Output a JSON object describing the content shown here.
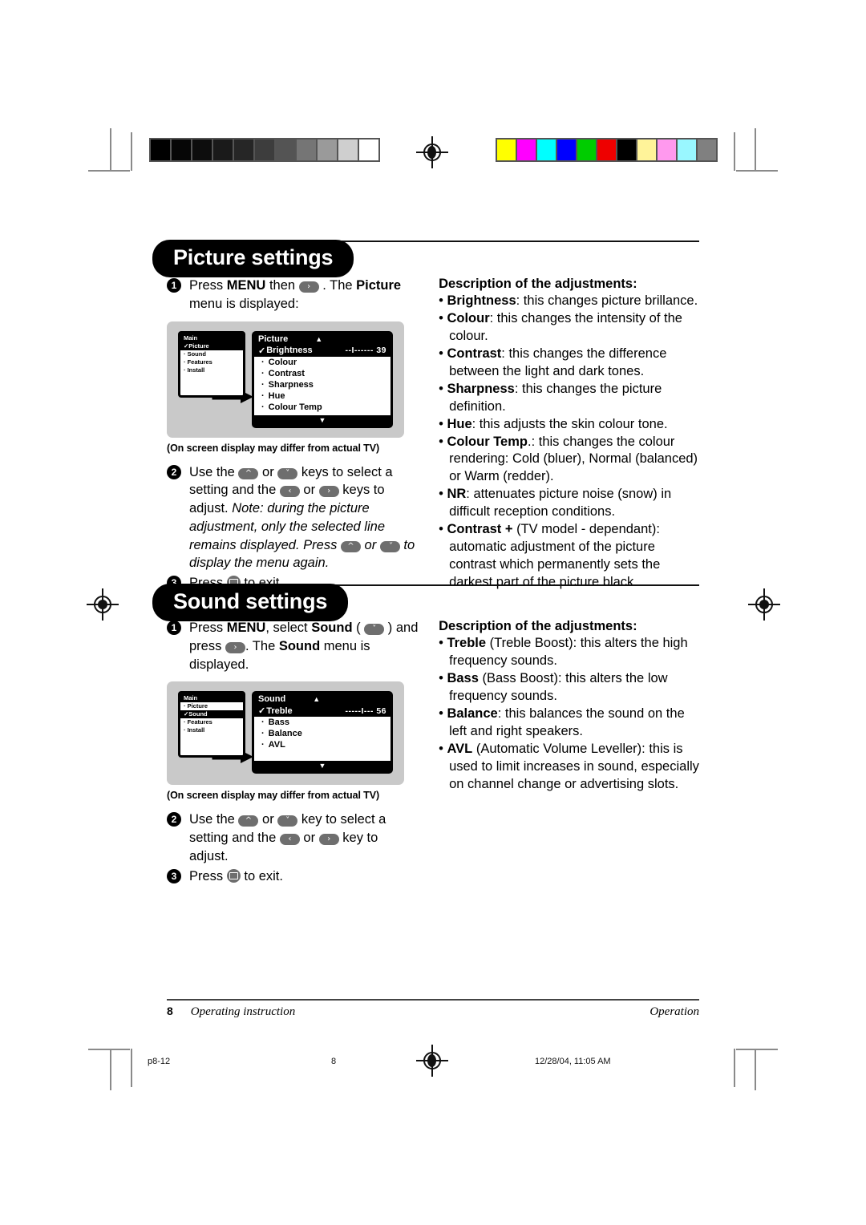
{
  "document": {
    "page_number": "8",
    "footer_left": "Operating instruction",
    "footer_right": "Operation",
    "print_file": "p8-12",
    "print_page": "8",
    "print_timestamp": "12/28/04, 11:05 AM"
  },
  "calibration": {
    "grayscale": [
      "#000000",
      "#060606",
      "#0d0d0d",
      "#1a1a1a",
      "#262626",
      "#3d3d3d",
      "#545454",
      "#757575",
      "#9a9a9a",
      "#cfcfcf",
      "#ffffff"
    ],
    "colors": [
      "#ffff00",
      "#ff00ff",
      "#00ffff",
      "#0000ff",
      "#00cc00",
      "#ee0000",
      "#000000",
      "#fff399",
      "#ff99ee",
      "#99f7ff",
      "#808080"
    ]
  },
  "picture_section": {
    "title": "Picture settings",
    "steps": [
      {
        "num": "1",
        "parts": [
          {
            "t": "text",
            "v": "Press "
          },
          {
            "t": "bold",
            "v": "MENU"
          },
          {
            "t": "text",
            "v": " then "
          },
          {
            "t": "key",
            "v": "right"
          },
          {
            "t": "text",
            "v": " . The "
          },
          {
            "t": "bold",
            "v": "Picture"
          },
          {
            "t": "text",
            "v": " menu is displayed:"
          }
        ]
      }
    ],
    "osd": {
      "sidebar_header": "Main",
      "sidebar_items": [
        {
          "label": "Picture",
          "selected": true
        },
        {
          "label": "Sound",
          "selected": false
        },
        {
          "label": "Features",
          "selected": false
        },
        {
          "label": "Install",
          "selected": false
        }
      ],
      "menu_title": "Picture",
      "up_caret": "▲",
      "down_caret": "▼",
      "highlighted_item": {
        "label": "Brightness",
        "value": "--I------",
        "number": "39",
        "check": "✓"
      },
      "items": [
        "Colour",
        "Contrast",
        "Sharpness",
        "Hue",
        "Colour Temp"
      ],
      "bullet": "·"
    },
    "caption": "(On screen display may differ from actual TV)",
    "step2_prefix": "Use the",
    "step2_or": "or",
    "step2_mid": "keys to select a setting and the",
    "step2_suffix": "keys to adjust.",
    "note_line1": "Note: during the picture adjustment, only",
    "note_line2": "the selected line remains displayed. Press",
    "note_line3_or": "or",
    "note_line3_tail": "to display the menu again.",
    "step3_press": "Press",
    "step3_tail": "to exit.",
    "desc_title": "Description of the adjustments:",
    "descriptions": [
      {
        "term": "Brightness",
        "rest": ": this changes picture brillance."
      },
      {
        "term": "Colour",
        "rest": ": this changes the intensity of the colour."
      },
      {
        "term": "Contrast",
        "rest": ": this changes the difference between the light and dark tones."
      },
      {
        "term": "Sharpness",
        "rest": ": this changes the picture definition."
      },
      {
        "term": "Hue",
        "rest": ": this adjusts the skin colour tone."
      },
      {
        "term": "Colour Temp",
        "rest": ".: this changes the colour rendering: Cold (bluer), Normal (balanced) or Warm (redder)."
      },
      {
        "term": "NR",
        "rest": ": attenuates picture noise (snow) in difficult reception conditions."
      },
      {
        "term": "Contrast +",
        "rest": " (TV model - dependant): automatic adjustment of the picture contrast which permanently sets the darkest part of the picture black."
      }
    ]
  },
  "sound_section": {
    "title": "Sound settings",
    "step1": {
      "num": "1",
      "a": "Press ",
      "menu": "MENU",
      "b": ", select ",
      "sound": "Sound",
      "c": " (",
      "d": ") and press ",
      "e": ". The ",
      "sound2": "Sound",
      "f": " menu is displayed."
    },
    "osd": {
      "sidebar_header": "Main",
      "sidebar_items": [
        {
          "label": "Picture",
          "selected": false
        },
        {
          "label": "Sound",
          "selected": true
        },
        {
          "label": "Features",
          "selected": false
        },
        {
          "label": "Install",
          "selected": false
        }
      ],
      "menu_title": "Sound",
      "up_caret": "▲",
      "down_caret": "▼",
      "highlighted_item": {
        "label": "Treble",
        "value": "-----I---",
        "number": "56",
        "check": "✓"
      },
      "items": [
        "Bass",
        "Balance",
        "AVL"
      ],
      "bullet": "·"
    },
    "caption": "(On screen display may differ from actual TV)",
    "step2_prefix": "Use the",
    "step2_or": "or",
    "step2_mid": "key to select a setting and the",
    "step2_suffix": "key to adjust.",
    "step3_press": "Press",
    "step3_tail": "to exit.",
    "desc_title": "Description of the adjustments:",
    "descriptions": [
      {
        "term": "Treble",
        "rest": " (Treble Boost): this alters the high frequency sounds."
      },
      {
        "term": "Bass",
        "rest": " (Bass Boost): this alters the low frequency sounds."
      },
      {
        "term": "Balance",
        "rest": ": this balances the sound on the left and right speakers."
      },
      {
        "term": "AVL",
        "rest": " (Automatic Volume Leveller): this is used to limit increases in sound, especially on channel change or advertising slots."
      }
    ]
  },
  "keys": {
    "up": "ⱏ",
    "down": "ⱟ",
    "left": "‹",
    "right": "›",
    "menu_icon": "menu-key"
  }
}
